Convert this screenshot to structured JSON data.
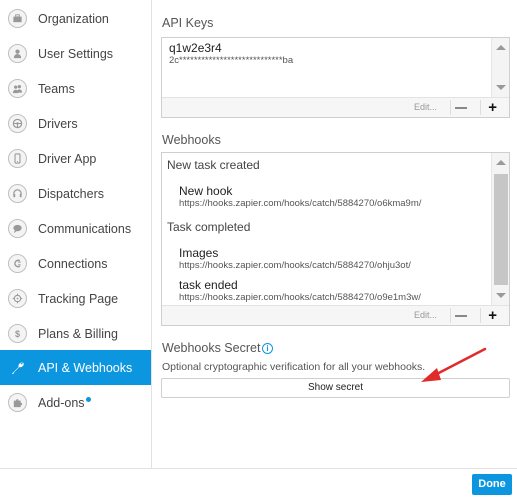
{
  "sidebar": {
    "items": [
      {
        "label": "Organization",
        "icon": "briefcase-icon"
      },
      {
        "label": "User Settings",
        "icon": "user-icon"
      },
      {
        "label": "Teams",
        "icon": "team-icon"
      },
      {
        "label": "Drivers",
        "icon": "steering-wheel-icon"
      },
      {
        "label": "Driver App",
        "icon": "phone-icon"
      },
      {
        "label": "Dispatchers",
        "icon": "headset-icon"
      },
      {
        "label": "Communications",
        "icon": "chat-icon"
      },
      {
        "label": "Connections",
        "icon": "plug-icon"
      },
      {
        "label": "Tracking Page",
        "icon": "crosshair-icon"
      },
      {
        "label": "Plans & Billing",
        "icon": "dollar-icon"
      },
      {
        "label": "API & Webhooks",
        "icon": "wrench-icon"
      },
      {
        "label": "Add-ons",
        "icon": "puzzle-icon"
      }
    ],
    "active_index": 10,
    "accent": "#0d96e0"
  },
  "api_keys": {
    "title": "API Keys",
    "keys": [
      {
        "name": "q1w2e3r4",
        "masked": "2c****************************ba"
      }
    ],
    "toolbar": {
      "edit": "Edit...",
      "remove": "−",
      "add": "+"
    }
  },
  "webhooks": {
    "title": "Webhooks",
    "groups": [
      {
        "event": "New task created",
        "hooks": [
          {
            "name": "New hook",
            "url": "https://hooks.zapier.com/hooks/catch/5884270/o6kma9m/"
          }
        ]
      },
      {
        "event": "Task completed",
        "hooks": [
          {
            "name": "Images",
            "url": "https://hooks.zapier.com/hooks/catch/5884270/ohju3ot/"
          },
          {
            "name": "task ended",
            "url": "https://hooks.zapier.com/hooks/catch/5884270/o9e1m3w/"
          }
        ]
      }
    ],
    "toolbar": {
      "edit": "Edit...",
      "remove": "−",
      "add": "+"
    }
  },
  "webhooks_secret": {
    "title": "Webhooks Secret",
    "info": "i",
    "description": "Optional cryptographic verification for all your webhooks.",
    "button": "Show secret",
    "annotation_color": "#e02b2b"
  },
  "footer": {
    "done": "Done"
  }
}
